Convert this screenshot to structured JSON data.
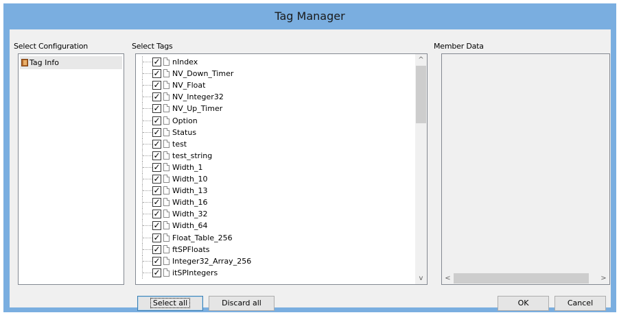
{
  "window": {
    "title": "Tag Manager"
  },
  "labels": {
    "select_configuration": "Select Configuration",
    "select_tags": "Select Tags",
    "member_data": "Member Data"
  },
  "configurations": [
    {
      "label": "Tag Info",
      "icon": "book-icon",
      "selected": true
    }
  ],
  "tags": [
    {
      "label": "nIndex",
      "checked": true
    },
    {
      "label": "NV_Down_Timer",
      "checked": true
    },
    {
      "label": "NV_Float",
      "checked": true
    },
    {
      "label": "NV_Integer32",
      "checked": true
    },
    {
      "label": "NV_Up_Timer",
      "checked": true
    },
    {
      "label": "Option",
      "checked": true
    },
    {
      "label": "Status",
      "checked": true
    },
    {
      "label": "test",
      "checked": true
    },
    {
      "label": "test_string",
      "checked": true
    },
    {
      "label": "Width_1",
      "checked": true
    },
    {
      "label": "Width_10",
      "checked": true
    },
    {
      "label": "Width_13",
      "checked": true
    },
    {
      "label": "Width_16",
      "checked": true
    },
    {
      "label": "Width_32",
      "checked": true
    },
    {
      "label": "Width_64",
      "checked": true
    },
    {
      "label": "Float_Table_256",
      "checked": true
    },
    {
      "label": "ftSPFloats",
      "checked": true
    },
    {
      "label": "Integer32_Array_256",
      "checked": true
    },
    {
      "label": "itSPIntegers",
      "checked": true
    }
  ],
  "buttons": {
    "select_all": "Select all",
    "discard_all": "Discard all",
    "ok": "OK",
    "cancel": "Cancel"
  },
  "scroll_glyphs": {
    "up": "^",
    "down": "v",
    "left": "<",
    "right": ">"
  },
  "colors": {
    "title_bar": "#7aaee0",
    "client_bg": "#f0f0f0",
    "selected_config_bg": "#e8e8e8"
  }
}
